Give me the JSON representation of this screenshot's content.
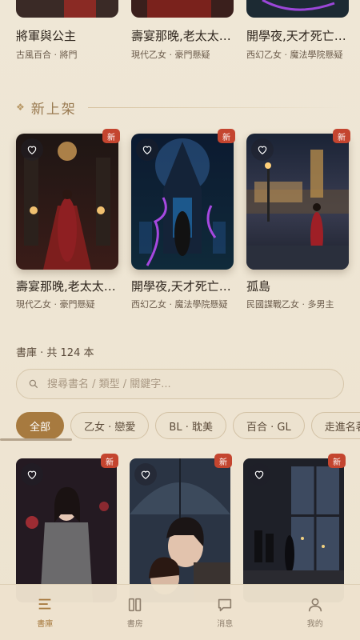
{
  "top_row": [
    {
      "title": "將軍與公主",
      "meta": "古風百合 · 將門"
    },
    {
      "title": "壽宴那晚,老太太開口了",
      "meta": "現代乙女 · 豪門懸疑"
    },
    {
      "title": "開學夜,天才死亡之謎",
      "meta": "西幻乙女 · 魔法學院懸疑"
    }
  ],
  "section": {
    "title": "新上架"
  },
  "new_books": [
    {
      "title": "壽宴那晚,老太太開口了",
      "meta": "現代乙女 · 豪門懸疑",
      "badge": "新"
    },
    {
      "title": "開學夜,天才死亡之謎",
      "meta": "西幻乙女 · 魔法學院懸疑",
      "badge": "新"
    },
    {
      "title": "孤島",
      "meta": "民國諜戰乙女 · 多男主",
      "badge": "新"
    }
  ],
  "library": {
    "count_text": "書庫 · 共 124 本",
    "search_placeholder": "搜尋書名 / 類型 / 關鍵字...",
    "chips": [
      "全部",
      "乙女 · 戀愛",
      "BL · 耽美",
      "百合 · GL",
      "走進名著"
    ],
    "active_chip": "全部",
    "grid_badges": [
      "新",
      "新",
      "新"
    ]
  },
  "bottom_nav": [
    {
      "label": "書庫",
      "icon": "book-list-icon",
      "active": true
    },
    {
      "label": "書房",
      "icon": "bookshelf-icon",
      "active": false
    },
    {
      "label": "消息",
      "icon": "chat-bubble-icon",
      "active": false
    },
    {
      "label": "我的",
      "icon": "person-icon",
      "active": false
    }
  ],
  "colors": {
    "accent": "#a77a3f",
    "badge": "#c4452f",
    "background": "#efe6d5"
  }
}
